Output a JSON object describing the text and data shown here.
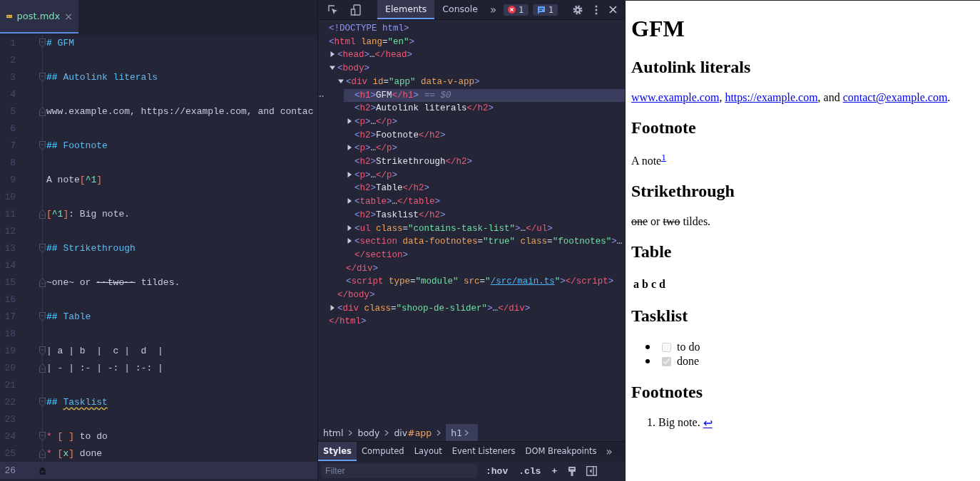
{
  "editor": {
    "tab": {
      "label": "post.mdx",
      "close": "×",
      "selected": true
    },
    "lines": [
      {
        "number": "1",
        "kind": "fold-start",
        "segments": [
          {
            "text": "# ",
            "kind": "heading-mark"
          },
          {
            "text": "GFM",
            "kind": "heading"
          }
        ]
      },
      {
        "number": "2"
      },
      {
        "number": "3",
        "kind": "fold-start",
        "segments": [
          {
            "text": "## ",
            "kind": "heading-mark"
          },
          {
            "text": "Autolink literals",
            "kind": "heading"
          }
        ]
      },
      {
        "number": "4"
      },
      {
        "number": "5",
        "kind": "fold-end",
        "segments": [
          {
            "text": "www.example.com, https://example.com, and contac",
            "kind": "text"
          }
        ]
      },
      {
        "number": "6"
      },
      {
        "number": "7",
        "kind": "fold-start",
        "segments": [
          {
            "text": "## ",
            "kind": "heading-mark"
          },
          {
            "text": "Footnote",
            "kind": "heading"
          }
        ]
      },
      {
        "number": "8"
      },
      {
        "number": "9",
        "segments": [
          {
            "text": "A note",
            "kind": "text"
          },
          {
            "text": "[",
            "kind": "bracket"
          },
          {
            "text": "^1",
            "kind": "ref"
          },
          {
            "text": "]",
            "kind": "bracket"
          }
        ]
      },
      {
        "number": "10"
      },
      {
        "number": "11",
        "kind": "fold-end",
        "segments": [
          {
            "text": "[",
            "kind": "bracket"
          },
          {
            "text": "^1",
            "kind": "ref"
          },
          {
            "text": "]",
            "kind": "bracket"
          },
          {
            "text": ": Big note.",
            "kind": "text"
          }
        ]
      },
      {
        "number": "12"
      },
      {
        "number": "13",
        "kind": "fold-start",
        "segments": [
          {
            "text": "## ",
            "kind": "heading-mark"
          },
          {
            "text": "Strikethrough",
            "kind": "heading"
          }
        ]
      },
      {
        "number": "14"
      },
      {
        "number": "15",
        "kind": "fold-end",
        "segments": [
          {
            "text": "~one~ or ",
            "kind": "text"
          },
          {
            "text": "~~two~~",
            "kind": "strike"
          },
          {
            "text": " tildes.",
            "kind": "text"
          }
        ]
      },
      {
        "number": "16"
      },
      {
        "number": "17",
        "kind": "fold-start",
        "segments": [
          {
            "text": "## ",
            "kind": "heading-mark"
          },
          {
            "text": "Table",
            "kind": "heading"
          }
        ]
      },
      {
        "number": "18"
      },
      {
        "number": "19",
        "kind": "fold-start",
        "segments": [
          {
            "text": "| a | b  |  c |  d  |",
            "kind": "text"
          }
        ]
      },
      {
        "number": "20",
        "kind": "fold-end",
        "segments": [
          {
            "text": "| - | :- | -: | :-: |",
            "kind": "text"
          }
        ]
      },
      {
        "number": "21"
      },
      {
        "number": "22",
        "kind": "fold-start",
        "segments": [
          {
            "text": "## ",
            "kind": "heading-mark"
          },
          {
            "text": "Tasklist",
            "kind": "spelling"
          }
        ]
      },
      {
        "number": "23"
      },
      {
        "number": "24",
        "kind": "fold-start",
        "segments": [
          {
            "text": "* ",
            "kind": "star"
          },
          {
            "text": "[ ]",
            "kind": "bracket"
          },
          {
            "text": " to do",
            "kind": "text"
          }
        ]
      },
      {
        "number": "25",
        "kind": "fold-end",
        "segments": [
          {
            "text": "* ",
            "kind": "star"
          },
          {
            "text": "[",
            "kind": "bracket"
          },
          {
            "text": "x",
            "kind": "ref"
          },
          {
            "text": "]",
            "kind": "bracket"
          },
          {
            "text": " done",
            "kind": "text"
          }
        ]
      },
      {
        "number": "26",
        "current": true
      }
    ]
  },
  "devtools": {
    "tabs": [
      {
        "label": "Elements",
        "selected": true
      },
      {
        "label": "Console",
        "selected": false
      }
    ],
    "more": "»",
    "errors": "1",
    "messages": "1",
    "tree": [
      {
        "selected": false,
        "open": [
          {
            "text": "<!DOCTYPE html>",
            "kind": "bracket"
          }
        ]
      },
      {
        "selected": false,
        "open": [
          {
            "text": "<",
            "kind": "bracket"
          },
          {
            "text": "html",
            "kind": "tag"
          },
          {
            "text": " lang",
            "kind": "attr"
          },
          {
            "text": "=",
            "kind": "text"
          },
          {
            "text": "\"en\"",
            "kind": "value"
          },
          {
            "text": ">",
            "kind": "bracket"
          }
        ],
        "children": [
          {
            "selected": false,
            "expanded": false,
            "open": [
              {
                "text": "<",
                "kind": "bracket"
              },
              {
                "text": "head",
                "kind": "tag"
              },
              {
                "text": ">",
                "kind": "bracket"
              },
              {
                "text": "…",
                "kind": "text"
              },
              {
                "text": "</head",
                "kind": "tag"
              },
              {
                "text": ">",
                "kind": "bracket"
              }
            ]
          },
          {
            "selected": false,
            "expanded": true,
            "open": [
              {
                "text": "<",
                "kind": "bracket"
              },
              {
                "text": "body",
                "kind": "tag"
              },
              {
                "text": ">",
                "kind": "bracket"
              }
            ],
            "children": [
              {
                "selected": false,
                "expanded": true,
                "open": [
                  {
                    "text": "<",
                    "kind": "bracket"
                  },
                  {
                    "text": "div",
                    "kind": "tag"
                  },
                  {
                    "text": " id",
                    "kind": "attr"
                  },
                  {
                    "text": "=",
                    "kind": "text"
                  },
                  {
                    "text": "\"app\"",
                    "kind": "value"
                  },
                  {
                    "text": " data-v-app",
                    "kind": "attr"
                  },
                  {
                    "text": ">",
                    "kind": "bracket"
                  }
                ],
                "children": [
                  {
                    "selected": true,
                    "suffix": "== $0",
                    "open": [
                      {
                        "text": "<",
                        "kind": "bracket"
                      },
                      {
                        "text": "h1",
                        "kind": "tag"
                      },
                      {
                        "text": ">",
                        "kind": "bracket"
                      },
                      {
                        "text": "GFM",
                        "kind": "text"
                      },
                      {
                        "text": "</h1",
                        "kind": "tag"
                      },
                      {
                        "text": ">",
                        "kind": "bracket"
                      }
                    ]
                  },
                  {
                    "selected": false,
                    "open": [
                      {
                        "text": "<",
                        "kind": "bracket"
                      },
                      {
                        "text": "h2",
                        "kind": "tag"
                      },
                      {
                        "text": ">",
                        "kind": "bracket"
                      },
                      {
                        "text": "Autolink literals",
                        "kind": "text"
                      },
                      {
                        "text": "</h2",
                        "kind": "tag"
                      },
                      {
                        "text": ">",
                        "kind": "bracket"
                      }
                    ]
                  },
                  {
                    "selected": false,
                    "expanded": false,
                    "open": [
                      {
                        "text": "<",
                        "kind": "bracket"
                      },
                      {
                        "text": "p",
                        "kind": "tag"
                      },
                      {
                        "text": ">",
                        "kind": "bracket"
                      },
                      {
                        "text": "…",
                        "kind": "text"
                      },
                      {
                        "text": "</p",
                        "kind": "tag"
                      },
                      {
                        "text": ">",
                        "kind": "bracket"
                      }
                    ]
                  },
                  {
                    "selected": false,
                    "open": [
                      {
                        "text": "<",
                        "kind": "bracket"
                      },
                      {
                        "text": "h2",
                        "kind": "tag"
                      },
                      {
                        "text": ">",
                        "kind": "bracket"
                      },
                      {
                        "text": "Footnote",
                        "kind": "text"
                      },
                      {
                        "text": "</h2",
                        "kind": "tag"
                      },
                      {
                        "text": ">",
                        "kind": "bracket"
                      }
                    ]
                  },
                  {
                    "selected": false,
                    "expanded": false,
                    "open": [
                      {
                        "text": "<",
                        "kind": "bracket"
                      },
                      {
                        "text": "p",
                        "kind": "tag"
                      },
                      {
                        "text": ">",
                        "kind": "bracket"
                      },
                      {
                        "text": "…",
                        "kind": "text"
                      },
                      {
                        "text": "</p",
                        "kind": "tag"
                      },
                      {
                        "text": ">",
                        "kind": "bracket"
                      }
                    ]
                  },
                  {
                    "selected": false,
                    "open": [
                      {
                        "text": "<",
                        "kind": "bracket"
                      },
                      {
                        "text": "h2",
                        "kind": "tag"
                      },
                      {
                        "text": ">",
                        "kind": "bracket"
                      },
                      {
                        "text": "Strikethrough",
                        "kind": "text"
                      },
                      {
                        "text": "</h2",
                        "kind": "tag"
                      },
                      {
                        "text": ">",
                        "kind": "bracket"
                      }
                    ]
                  },
                  {
                    "selected": false,
                    "expanded": false,
                    "open": [
                      {
                        "text": "<",
                        "kind": "bracket"
                      },
                      {
                        "text": "p",
                        "kind": "tag"
                      },
                      {
                        "text": ">",
                        "kind": "bracket"
                      },
                      {
                        "text": "…",
                        "kind": "text"
                      },
                      {
                        "text": "</p",
                        "kind": "tag"
                      },
                      {
                        "text": ">",
                        "kind": "bracket"
                      }
                    ]
                  },
                  {
                    "selected": false,
                    "open": [
                      {
                        "text": "<",
                        "kind": "bracket"
                      },
                      {
                        "text": "h2",
                        "kind": "tag"
                      },
                      {
                        "text": ">",
                        "kind": "bracket"
                      },
                      {
                        "text": "Table",
                        "kind": "text"
                      },
                      {
                        "text": "</h2",
                        "kind": "tag"
                      },
                      {
                        "text": ">",
                        "kind": "bracket"
                      }
                    ]
                  },
                  {
                    "selected": false,
                    "expanded": false,
                    "open": [
                      {
                        "text": "<",
                        "kind": "bracket"
                      },
                      {
                        "text": "table",
                        "kind": "tag"
                      },
                      {
                        "text": ">",
                        "kind": "bracket"
                      },
                      {
                        "text": "…",
                        "kind": "text"
                      },
                      {
                        "text": "</table",
                        "kind": "tag"
                      },
                      {
                        "text": ">",
                        "kind": "bracket"
                      }
                    ]
                  },
                  {
                    "selected": false,
                    "open": [
                      {
                        "text": "<",
                        "kind": "bracket"
                      },
                      {
                        "text": "h2",
                        "kind": "tag"
                      },
                      {
                        "text": ">",
                        "kind": "bracket"
                      },
                      {
                        "text": "Tasklist",
                        "kind": "text"
                      },
                      {
                        "text": "</h2",
                        "kind": "tag"
                      },
                      {
                        "text": ">",
                        "kind": "bracket"
                      }
                    ]
                  },
                  {
                    "selected": false,
                    "expanded": false,
                    "open": [
                      {
                        "text": "<",
                        "kind": "bracket"
                      },
                      {
                        "text": "ul",
                        "kind": "tag"
                      },
                      {
                        "text": " class",
                        "kind": "attr"
                      },
                      {
                        "text": "=",
                        "kind": "text"
                      },
                      {
                        "text": "\"contains-task-list\"",
                        "kind": "value"
                      },
                      {
                        "text": ">",
                        "kind": "bracket"
                      },
                      {
                        "text": "…",
                        "kind": "text"
                      },
                      {
                        "text": "</ul",
                        "kind": "tag"
                      },
                      {
                        "text": ">",
                        "kind": "bracket"
                      }
                    ]
                  },
                  {
                    "selected": false,
                    "expanded": false,
                    "open": [
                      {
                        "text": "<",
                        "kind": "bracket"
                      },
                      {
                        "text": "section",
                        "kind": "tag"
                      },
                      {
                        "text": " data-footnotes",
                        "kind": "attr"
                      },
                      {
                        "text": "=",
                        "kind": "text"
                      },
                      {
                        "text": "\"true\"",
                        "kind": "value"
                      },
                      {
                        "text": " class",
                        "kind": "attr"
                      },
                      {
                        "text": "=",
                        "kind": "text"
                      },
                      {
                        "text": "\"footnotes\"",
                        "kind": "value"
                      },
                      {
                        "text": ">",
                        "kind": "bracket"
                      },
                      {
                        "text": "…",
                        "kind": "text"
                      },
                      {
                        "text": "</section",
                        "kind": "tag"
                      },
                      {
                        "text": ">",
                        "kind": "bracket"
                      }
                    ]
                  }
                ],
                "close": [
                  {
                    "text": "</div",
                    "kind": "tag"
                  },
                  {
                    "text": ">",
                    "kind": "bracket"
                  }
                ]
              },
              {
                "selected": false,
                "open": [
                  {
                    "text": "<",
                    "kind": "bracket"
                  },
                  {
                    "text": "script",
                    "kind": "tag"
                  },
                  {
                    "text": " type",
                    "kind": "attr"
                  },
                  {
                    "text": "=",
                    "kind": "text"
                  },
                  {
                    "text": "\"module\"",
                    "kind": "value"
                  },
                  {
                    "text": " src",
                    "kind": "attr"
                  },
                  {
                    "text": "=",
                    "kind": "text"
                  },
                  {
                    "text": "\"",
                    "kind": "value"
                  },
                  {
                    "text": "/src/main.ts",
                    "kind": "link"
                  },
                  {
                    "text": "\"",
                    "kind": "value"
                  },
                  {
                    "text": ">",
                    "kind": "bracket"
                  },
                  {
                    "text": "</script",
                    "kind": "tag"
                  },
                  {
                    "text": ">",
                    "kind": "bracket"
                  }
                ]
              }
            ],
            "close": [
              {
                "text": "</body",
                "kind": "tag"
              },
              {
                "text": ">",
                "kind": "bracket"
              }
            ]
          },
          {
            "selected": false,
            "expanded": false,
            "open": [
              {
                "text": "<",
                "kind": "bracket"
              },
              {
                "text": "div",
                "kind": "tag"
              },
              {
                "text": " class",
                "kind": "attr"
              },
              {
                "text": "=",
                "kind": "text"
              },
              {
                "text": "\"shoop-de-slider\"",
                "kind": "value"
              },
              {
                "text": ">",
                "kind": "bracket"
              },
              {
                "text": "…",
                "kind": "text"
              },
              {
                "text": "</div",
                "kind": "tag"
              },
              {
                "text": ">",
                "kind": "bracket"
              }
            ]
          }
        ],
        "close": [
          {
            "text": "</html",
            "kind": "tag"
          },
          {
            "text": ">",
            "kind": "bracket"
          }
        ]
      }
    ],
    "breadcrumbs": [
      {
        "label": "html",
        "selected": false
      },
      {
        "label": "body",
        "selected": false
      },
      {
        "label": "div",
        "id": "#app",
        "selected": false
      },
      {
        "label": "h1",
        "selected": true
      }
    ],
    "panel_tabs": [
      {
        "label": "Styles",
        "selected": true
      },
      {
        "label": "Computed",
        "selected": false
      },
      {
        "label": "Layout",
        "selected": false
      },
      {
        "label": "Event Listeners",
        "selected": false
      },
      {
        "label": "DOM Breakpoints",
        "selected": false
      }
    ],
    "panel_more": "»",
    "filter": {
      "placeholder": "Filter"
    },
    "style_tools": [
      ":hov",
      ".cls",
      "+"
    ]
  },
  "preview": {
    "blocks": [
      {
        "kind": "h1",
        "text": "GFM"
      },
      {
        "kind": "h2",
        "text": "Autolink literals"
      },
      {
        "kind": "paragraph",
        "segments": [
          {
            "text": "www.example.com",
            "kind": "link"
          },
          {
            "text": ", ",
            "kind": "text"
          },
          {
            "text": "https://example.com",
            "kind": "link"
          },
          {
            "text": ", and ",
            "kind": "text"
          },
          {
            "text": "contact@example.com",
            "kind": "link"
          },
          {
            "text": ".",
            "kind": "text"
          }
        ]
      },
      {
        "kind": "h2",
        "text": "Footnote"
      },
      {
        "kind": "paragraph",
        "segments": [
          {
            "text": "A note",
            "kind": "text"
          },
          {
            "text": "1",
            "kind": "footnote-ref"
          }
        ]
      },
      {
        "kind": "h2",
        "text": "Strikethrough"
      },
      {
        "kind": "paragraph",
        "segments": [
          {
            "text": "one",
            "kind": "strike"
          },
          {
            "text": " or ",
            "kind": "text"
          },
          {
            "text": "two",
            "kind": "strike"
          },
          {
            "text": " tildes.",
            "kind": "text"
          }
        ]
      },
      {
        "kind": "h2",
        "text": "Table"
      },
      {
        "kind": "table",
        "headers": [
          "a",
          "b",
          "c",
          "d"
        ]
      },
      {
        "kind": "h2",
        "text": "Tasklist"
      },
      {
        "kind": "tasklist",
        "items": [
          {
            "label": "to do",
            "checked": false,
            "disabled": true
          },
          {
            "label": "done",
            "checked": true,
            "disabled": true
          }
        ]
      },
      {
        "kind": "h2",
        "text": "Footnotes"
      },
      {
        "kind": "footnotes",
        "items": [
          {
            "number": "1.",
            "text": "Big note.",
            "backref": "↩"
          }
        ]
      }
    ]
  }
}
